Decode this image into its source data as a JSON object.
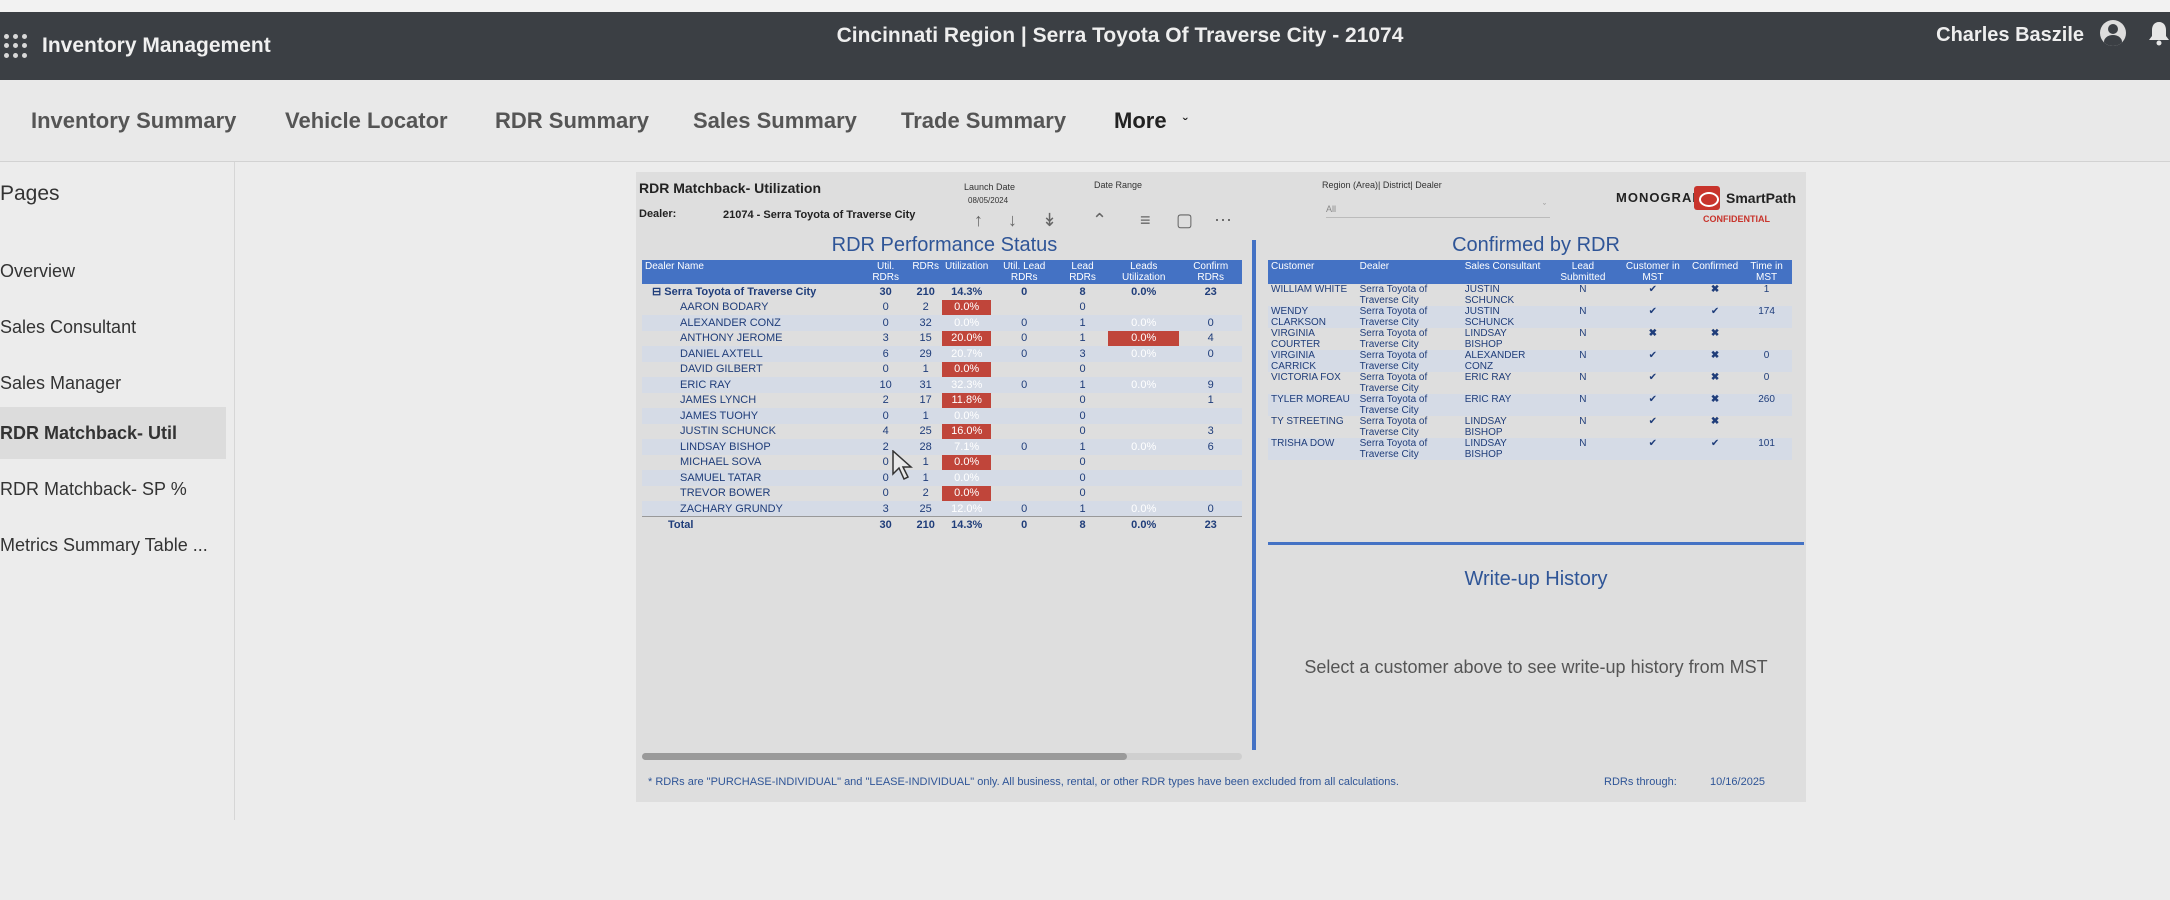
{
  "app": {
    "title": "Inventory Management",
    "context": "Cincinnati Region |   Serra Toyota Of Traverse City - 21074",
    "user": "Charles Baszile"
  },
  "nav": {
    "items": [
      "Inventory Summary",
      "Vehicle Locator",
      "RDR Summary",
      "Sales Summary",
      "Trade Summary"
    ],
    "more": "More"
  },
  "sidebar": {
    "title": "Pages",
    "items": [
      "Overview",
      "Sales Consultant",
      "Sales Manager",
      "RDR Matchback- Util",
      "RDR Matchback- SP %",
      "Metrics Summary Table ..."
    ],
    "active_index": 3
  },
  "report": {
    "title": "RDR Matchback- Utilization",
    "dealer_label": "Dealer:",
    "dealer_value": "21074 - Serra Toyota of Traverse City",
    "launch_date_label": "Launch Date",
    "launch_date_value": "08/05/2024",
    "date_range_label": "Date Range",
    "region_label": "Region (Area)| District| Dealer",
    "region_value": "All",
    "monogram": "MONOGRAM",
    "smartpath": "SmartPath",
    "confidential": "CONFIDENTIAL",
    "rdr_performance": {
      "title": "RDR Performance Status",
      "headers": [
        "Dealer Name",
        "Util. RDRs",
        "RDRs",
        "Utilization",
        "Util. Lead RDRs",
        "Lead RDRs",
        "Leads Utilization",
        "Confirm RDRs"
      ],
      "dealer_row": [
        "Serra Toyota of Traverse City",
        "30",
        "210",
        "14.3%",
        "0",
        "8",
        "0.0%",
        "23"
      ],
      "rows": [
        [
          "AARON BODARY",
          "0",
          "2",
          "0.0%",
          "",
          "0",
          "",
          ""
        ],
        [
          "ALEXANDER CONZ",
          "0",
          "32",
          "0.0%",
          "0",
          "1",
          "0.0%",
          "0"
        ],
        [
          "ANTHONY JEROME",
          "3",
          "15",
          "20.0%",
          "0",
          "1",
          "0.0%",
          "4"
        ],
        [
          "DANIEL AXTELL",
          "6",
          "29",
          "20.7%",
          "0",
          "3",
          "0.0%",
          "0"
        ],
        [
          "DAVID GILBERT",
          "0",
          "1",
          "0.0%",
          "",
          "0",
          "",
          ""
        ],
        [
          "ERIC RAY",
          "10",
          "31",
          "32.3%",
          "0",
          "1",
          "0.0%",
          "9"
        ],
        [
          "JAMES LYNCH",
          "2",
          "17",
          "11.8%",
          "",
          "0",
          "",
          "1"
        ],
        [
          "JAMES TUOHY",
          "0",
          "1",
          "0.0%",
          "",
          "0",
          "",
          ""
        ],
        [
          "JUSTIN SCHUNCK",
          "4",
          "25",
          "16.0%",
          "",
          "0",
          "",
          "3"
        ],
        [
          "LINDSAY BISHOP",
          "2",
          "28",
          "7.1%",
          "0",
          "1",
          "0.0%",
          "6"
        ],
        [
          "MICHAEL SOVA",
          "0",
          "1",
          "0.0%",
          "",
          "0",
          "",
          ""
        ],
        [
          "SAMUEL TATAR",
          "0",
          "1",
          "0.0%",
          "",
          "0",
          "",
          ""
        ],
        [
          "TREVOR BOWER",
          "0",
          "2",
          "0.0%",
          "",
          "0",
          "",
          ""
        ],
        [
          "ZACHARY GRUNDY",
          "3",
          "25",
          "12.0%",
          "0",
          "1",
          "0.0%",
          "0"
        ]
      ],
      "total_row": [
        "Total",
        "30",
        "210",
        "14.3%",
        "0",
        "8",
        "0.0%",
        "23"
      ]
    },
    "confirmed": {
      "title": "Confirmed by RDR",
      "headers": [
        "Customer",
        "Dealer",
        "Sales Consultant",
        "Lead Submitted",
        "Customer in MST",
        "Confirmed",
        "Time in MST"
      ],
      "rows": [
        [
          "WILLIAM WHITE",
          "Serra Toyota of Traverse City",
          "JUSTIN SCHUNCK",
          "N",
          "check",
          "cross",
          "1"
        ],
        [
          "WENDY CLARKSON",
          "Serra Toyota of Traverse City",
          "JUSTIN SCHUNCK",
          "N",
          "check",
          "check",
          "174"
        ],
        [
          "VIRGINIA COURTER",
          "Serra Toyota of Traverse City",
          "LINDSAY BISHOP",
          "N",
          "cross",
          "cross",
          ""
        ],
        [
          "VIRGINIA CARRICK",
          "Serra Toyota of Traverse City",
          "ALEXANDER CONZ",
          "N",
          "check",
          "cross",
          "0"
        ],
        [
          "VICTORIA FOX",
          "Serra Toyota of Traverse City",
          "ERIC RAY",
          "N",
          "check",
          "cross",
          "0"
        ],
        [
          "TYLER MOREAU",
          "Serra Toyota of Traverse City",
          "ERIC RAY",
          "N",
          "check",
          "cross",
          "260"
        ],
        [
          "TY STREETING",
          "Serra Toyota of Traverse City",
          "LINDSAY BISHOP",
          "N",
          "check",
          "cross",
          ""
        ],
        [
          "TRISHA DOW",
          "Serra Toyota of Traverse City",
          "LINDSAY BISHOP",
          "N",
          "check",
          "check",
          "101"
        ]
      ]
    },
    "writeup": {
      "title": "Write-up History",
      "message": "Select a customer above to see write-up history from MST"
    },
    "footnote": "* RDRs are \"PURCHASE-INDIVIDUAL\" and \"LEASE-INDIVIDUAL\" only. All business, rental, or other RDR types have been excluded from all calculations.",
    "rdrs_through_label": "RDRs through:",
    "rdrs_through_date": "10/16/2025"
  }
}
